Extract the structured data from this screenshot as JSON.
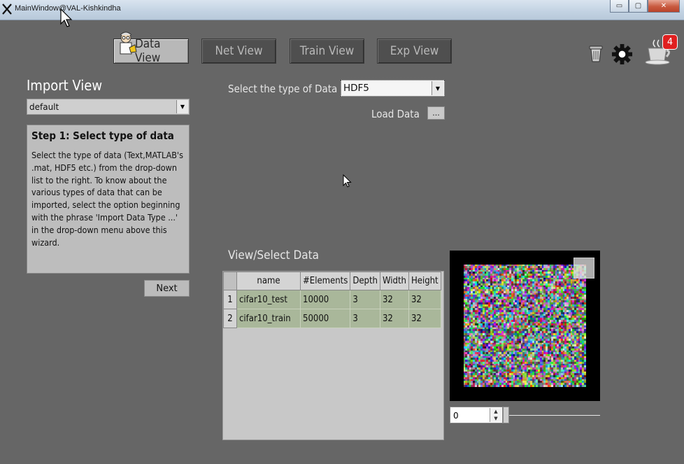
{
  "window": {
    "title": "MainWindow@VAL-Kishkindha",
    "minimize_label": "▭",
    "maximize_label": "▢",
    "close_label": "✕"
  },
  "nav": {
    "tabs": [
      {
        "label": "Data View",
        "active": true
      },
      {
        "label": "Net View",
        "active": false
      },
      {
        "label": "Train View",
        "active": false
      },
      {
        "label": "Exp View",
        "active": false
      }
    ]
  },
  "toolbar": {
    "icons": [
      "trash-icon",
      "gear-icon",
      "coffee-cup-icon"
    ],
    "notification_count": "4"
  },
  "import_panel": {
    "title": "Import View",
    "profile_value": "default",
    "step_title": "Step 1: Select type of data",
    "step_text": "Select the type of data (Text,MATLAB's .mat, HDF5 etc.) from the drop-down list to the right. To know about the various types of data that can be imported, select the option beginning with the phrase 'Import Data Type ...' in the drop-down menu above this wizard.",
    "next_label": "Next"
  },
  "data_select": {
    "type_label": "Select the type of Data",
    "type_value": "HDF5",
    "load_label": "Load Data",
    "browse_label": "..."
  },
  "view_select": {
    "title": "View/Select  Data",
    "columns": [
      "name",
      "#Elements",
      "Depth",
      "Width",
      "Height"
    ],
    "rows": [
      {
        "index": "1",
        "name": "cifar10_test",
        "elements": "10000",
        "depth": "3",
        "width": "32",
        "height": "32"
      },
      {
        "index": "2",
        "name": "cifar10_train",
        "elements": "50000",
        "depth": "3",
        "width": "32",
        "height": "32"
      }
    ]
  },
  "preview": {
    "index_value": "0",
    "slider_fraction": 0.0
  }
}
